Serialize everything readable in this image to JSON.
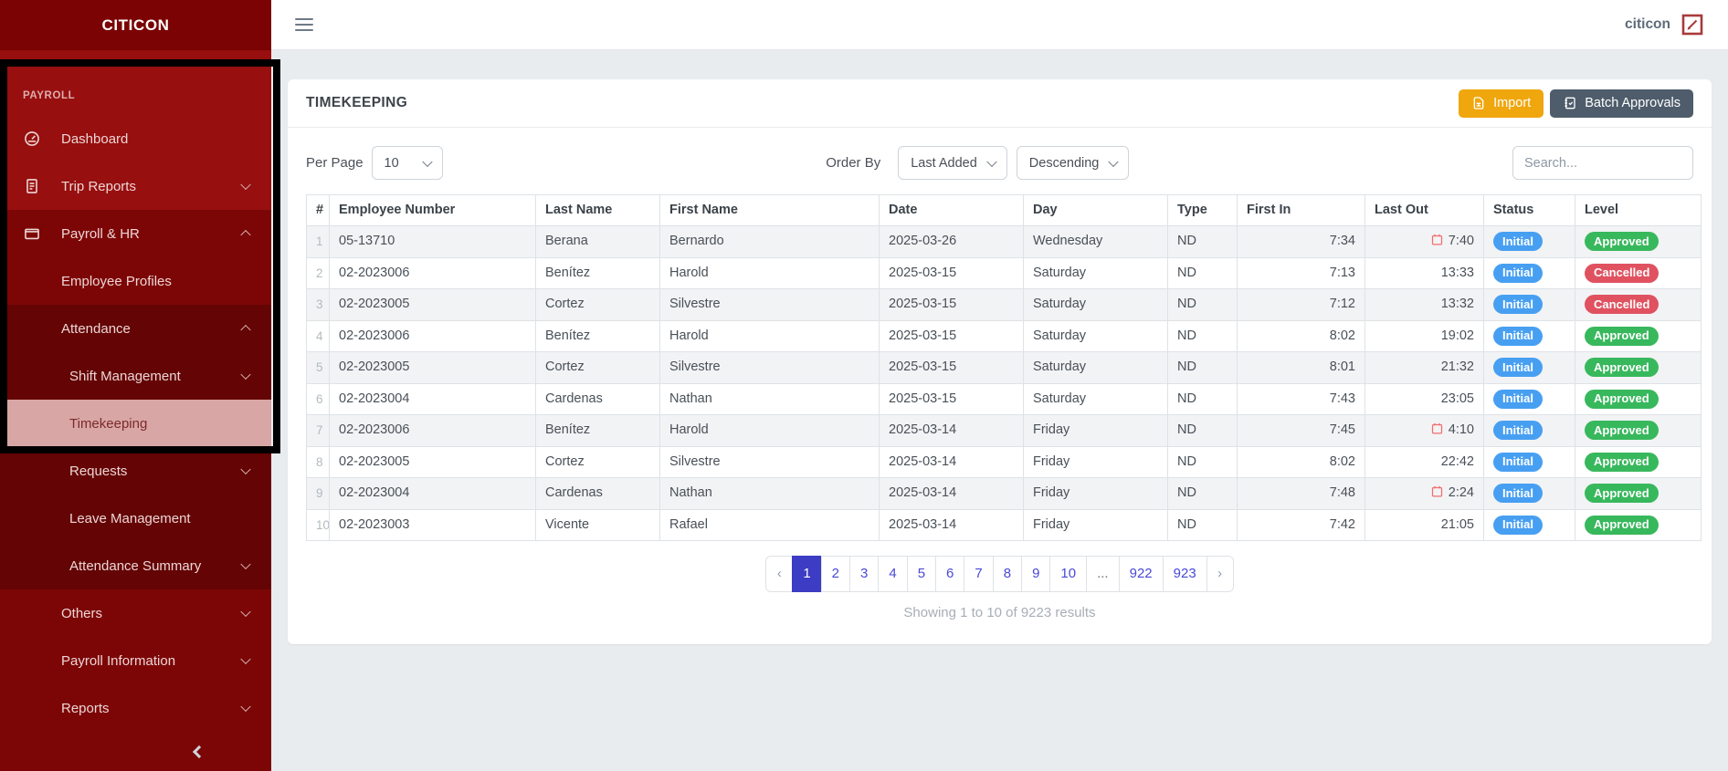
{
  "brand": {
    "sidebar_logo": "CITICON",
    "topbar_brand": "citicon",
    "topbar_logo_icon": "edit-square-logo-icon"
  },
  "sidebar": {
    "section_label": "PAYROLL",
    "collapse_icon": "collapse-left-icon",
    "items": [
      {
        "label": "Dashboard",
        "icon": "speedometer-icon",
        "level": 0,
        "chevron": null,
        "group": "base",
        "active": false
      },
      {
        "label": "Trip Reports",
        "icon": "document-icon",
        "level": 0,
        "chevron": "down",
        "group": "base",
        "active": false
      },
      {
        "label": "Payroll & HR",
        "icon": "wallet-icon",
        "level": 0,
        "chevron": "up",
        "group": "g1",
        "active": false
      },
      {
        "label": "Employee Profiles",
        "icon": null,
        "level": 1,
        "chevron": null,
        "group": "g1",
        "active": false
      },
      {
        "label": "Attendance",
        "icon": null,
        "level": 1,
        "chevron": "up",
        "group": "g2",
        "active": false
      },
      {
        "label": "Shift Management",
        "icon": null,
        "level": 2,
        "chevron": "down",
        "group": "g2",
        "active": false
      },
      {
        "label": "Timekeeping",
        "icon": null,
        "level": 2,
        "chevron": null,
        "group": "g2",
        "active": true
      },
      {
        "label": "Requests",
        "icon": null,
        "level": 2,
        "chevron": "down",
        "group": "g2",
        "active": false
      },
      {
        "label": "Leave Management",
        "icon": null,
        "level": 2,
        "chevron": null,
        "group": "g2",
        "active": false
      },
      {
        "label": "Attendance Summary",
        "icon": null,
        "level": 2,
        "chevron": "down",
        "group": "g2",
        "active": false
      },
      {
        "label": "Others",
        "icon": null,
        "level": 1,
        "chevron": "down",
        "group": "g1",
        "active": false
      },
      {
        "label": "Payroll Information",
        "icon": null,
        "level": 1,
        "chevron": "down",
        "group": "g1",
        "active": false
      },
      {
        "label": "Reports",
        "icon": null,
        "level": 1,
        "chevron": "down",
        "group": "g1",
        "active": false
      }
    ]
  },
  "page": {
    "title": "TIMEKEEPING",
    "import_label": "Import",
    "import_icon": "spreadsheet-icon",
    "batch_approvals_label": "Batch Approvals",
    "batch_approvals_icon": "checklist-icon"
  },
  "controls": {
    "per_page_label": "Per Page",
    "per_page_value": "10",
    "order_by_label": "Order By",
    "order_field_value": "Last Added",
    "order_direction_value": "Descending",
    "search_placeholder": "Search..."
  },
  "table": {
    "columns": [
      "#",
      "Employee Number",
      "Last Name",
      "First Name",
      "Date",
      "Day",
      "Type",
      "First In",
      "Last Out",
      "Status",
      "Level"
    ],
    "rows": [
      {
        "num": "1",
        "employee_number": "05-13710",
        "last_name": "Berana",
        "first_name": "Bernardo",
        "date": "2025-03-26",
        "day": "Wednesday",
        "type": "ND",
        "first_in": "7:34",
        "last_out": "7:40",
        "last_out_has_calendar": true,
        "status": "Initial",
        "level": "Approved"
      },
      {
        "num": "2",
        "employee_number": "02-2023006",
        "last_name": "Benítez",
        "first_name": "Harold",
        "date": "2025-03-15",
        "day": "Saturday",
        "type": "ND",
        "first_in": "7:13",
        "last_out": "13:33",
        "last_out_has_calendar": false,
        "status": "Initial",
        "level": "Cancelled"
      },
      {
        "num": "3",
        "employee_number": "02-2023005",
        "last_name": "Cortez",
        "first_name": "Silvestre",
        "date": "2025-03-15",
        "day": "Saturday",
        "type": "ND",
        "first_in": "7:12",
        "last_out": "13:32",
        "last_out_has_calendar": false,
        "status": "Initial",
        "level": "Cancelled"
      },
      {
        "num": "4",
        "employee_number": "02-2023006",
        "last_name": "Benítez",
        "first_name": "Harold",
        "date": "2025-03-15",
        "day": "Saturday",
        "type": "ND",
        "first_in": "8:02",
        "last_out": "19:02",
        "last_out_has_calendar": false,
        "status": "Initial",
        "level": "Approved"
      },
      {
        "num": "5",
        "employee_number": "02-2023005",
        "last_name": "Cortez",
        "first_name": "Silvestre",
        "date": "2025-03-15",
        "day": "Saturday",
        "type": "ND",
        "first_in": "8:01",
        "last_out": "21:32",
        "last_out_has_calendar": false,
        "status": "Initial",
        "level": "Approved"
      },
      {
        "num": "6",
        "employee_number": "02-2023004",
        "last_name": "Cardenas",
        "first_name": "Nathan",
        "date": "2025-03-15",
        "day": "Saturday",
        "type": "ND",
        "first_in": "7:43",
        "last_out": "23:05",
        "last_out_has_calendar": false,
        "status": "Initial",
        "level": "Approved"
      },
      {
        "num": "7",
        "employee_number": "02-2023006",
        "last_name": "Benítez",
        "first_name": "Harold",
        "date": "2025-03-14",
        "day": "Friday",
        "type": "ND",
        "first_in": "7:45",
        "last_out": "4:10",
        "last_out_has_calendar": true,
        "status": "Initial",
        "level": "Approved"
      },
      {
        "num": "8",
        "employee_number": "02-2023005",
        "last_name": "Cortez",
        "first_name": "Silvestre",
        "date": "2025-03-14",
        "day": "Friday",
        "type": "ND",
        "first_in": "8:02",
        "last_out": "22:42",
        "last_out_has_calendar": false,
        "status": "Initial",
        "level": "Approved"
      },
      {
        "num": "9",
        "employee_number": "02-2023004",
        "last_name": "Cardenas",
        "first_name": "Nathan",
        "date": "2025-03-14",
        "day": "Friday",
        "type": "ND",
        "first_in": "7:48",
        "last_out": "2:24",
        "last_out_has_calendar": true,
        "status": "Initial",
        "level": "Approved"
      },
      {
        "num": "10",
        "employee_number": "02-2023003",
        "last_name": "Vicente",
        "first_name": "Rafael",
        "date": "2025-03-14",
        "day": "Friday",
        "type": "ND",
        "first_in": "7:42",
        "last_out": "21:05",
        "last_out_has_calendar": false,
        "status": "Initial",
        "level": "Approved"
      }
    ]
  },
  "pagination": {
    "prev": "‹",
    "next": "›",
    "pages": [
      "1",
      "2",
      "3",
      "4",
      "5",
      "6",
      "7",
      "8",
      "9",
      "10",
      "...",
      "922",
      "923"
    ],
    "active": "1"
  },
  "summary": "Showing 1 to 10 of 9223 results",
  "colors": {
    "status_initial": "#479ff2",
    "level_approved": "#38b85c",
    "level_cancelled": "#e05260",
    "import_button": "#f0a60d",
    "batch_button": "#4e5c6b",
    "sidebar_active_bg": "#d9a6a6",
    "pagination_active": "#3c3cc4",
    "calendar_icon": "#f16d6d"
  }
}
